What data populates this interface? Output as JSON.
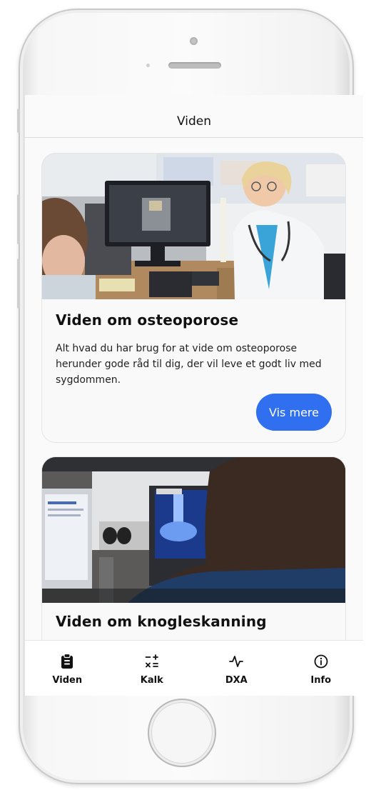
{
  "header": {
    "title": "Viden"
  },
  "cards": [
    {
      "title": "Viden om osteoporose",
      "description": "Alt hvad du har brug for at vide om osteoporose herunder gode råd til dig, der vil leve et godt liv med sygdommen.",
      "button_label": "Vis mere",
      "image_icon": "photo-doctor-at-computer"
    },
    {
      "title": "Viden om knogleskanning",
      "image_icon": "photo-dxa-scan-monitor"
    }
  ],
  "tabs": [
    {
      "label": "Viden",
      "icon": "clipboard-icon"
    },
    {
      "label": "Kalk",
      "icon": "calculator-icon"
    },
    {
      "label": "DXA",
      "icon": "pulse-icon"
    },
    {
      "label": "Info",
      "icon": "info-icon"
    }
  ],
  "colors": {
    "accent": "#2f6ff0",
    "text": "#111111",
    "background": "#fafafa"
  }
}
